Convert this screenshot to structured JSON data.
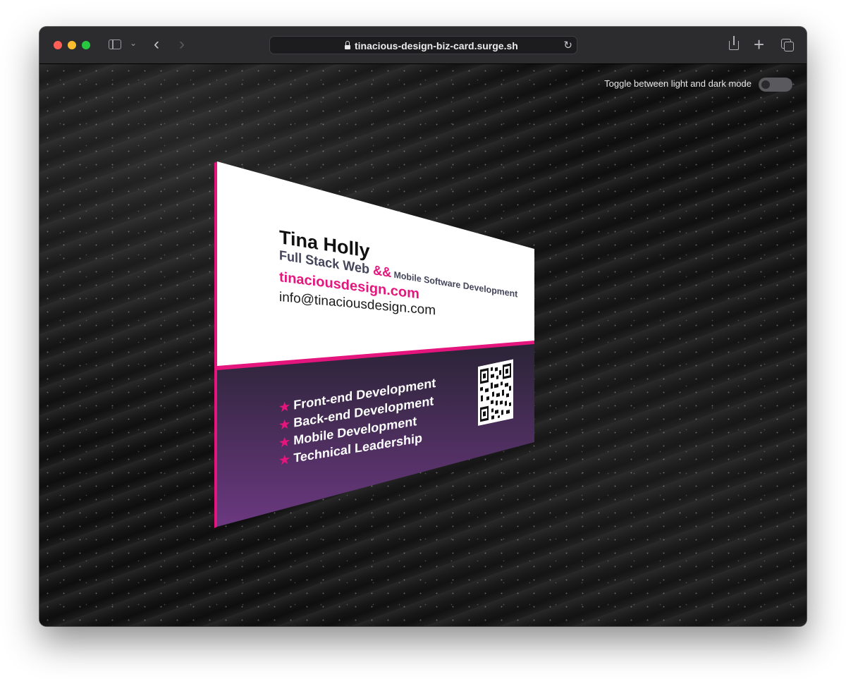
{
  "browser": {
    "url": "tinacious-design-biz-card.surge.sh"
  },
  "page": {
    "toggle_label": "Toggle between light and dark mode",
    "toggle_on": false
  },
  "card": {
    "name": "Tina Holly",
    "role_part1": "Full Stack Web ",
    "role_amp": "&&",
    "role_part2": " Mobile Software Development",
    "website": "tinaciousdesign.com",
    "email": "info@tinaciousdesign.com",
    "skills": [
      "Front-end Development",
      "Back-end Development",
      "Mobile Development",
      "Technical Leadership"
    ],
    "colors": {
      "accent": "#e5157e",
      "top_background": "#ffffff",
      "bottom_gradient_start": "#2a2436",
      "bottom_gradient_end": "#6b3880"
    }
  }
}
